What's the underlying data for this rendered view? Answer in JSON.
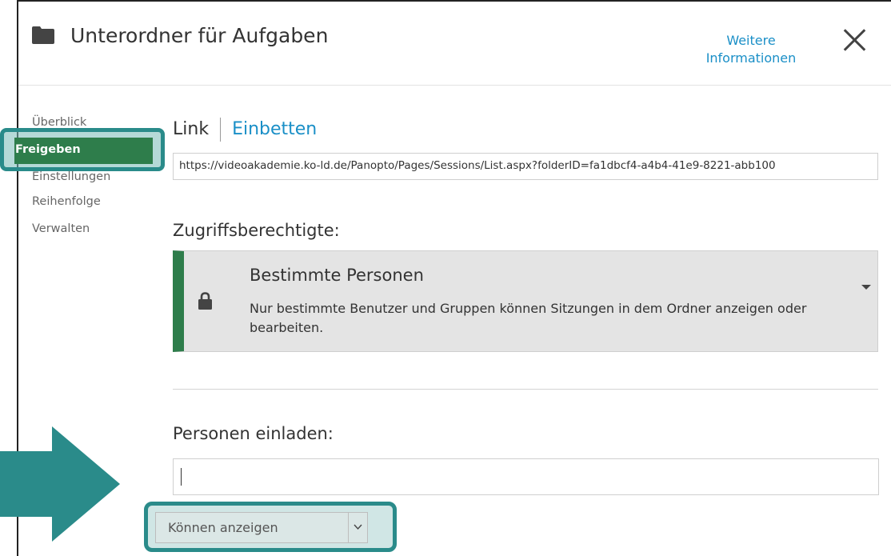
{
  "header": {
    "title": "Unterordner für Aufgaben",
    "more_info_line1": "Weitere",
    "more_info_line2": "Informationen"
  },
  "nav": {
    "items": [
      {
        "label": "Überblick"
      },
      {
        "label": "Freigeben",
        "active": true
      },
      {
        "label": "Einstellungen"
      },
      {
        "label": "Reihenfolge"
      },
      {
        "label": "Verwalten"
      }
    ]
  },
  "tabs": {
    "link": "Link",
    "embed": "Einbetten"
  },
  "share_url": "https://videoakademie.ko-ld.de/Panopto/Pages/Sessions/List.aspx?folderID=fa1dbcf4-a4b4-41e9-8221-abb100",
  "access": {
    "label": "Zugriffsberechtigte:",
    "title": "Bestimmte Personen",
    "description": "Nur bestimmte Benutzer und Gruppen können Sitzungen in dem Ordner anzeigen oder bearbeiten."
  },
  "invite": {
    "label": "Personen einladen:",
    "value": ""
  },
  "permission": {
    "selected": "Können anzeigen"
  },
  "colors": {
    "accent_green": "#2e7d4b",
    "link_blue": "#1a8fc7",
    "overlay_teal": "#2a8b8a"
  }
}
